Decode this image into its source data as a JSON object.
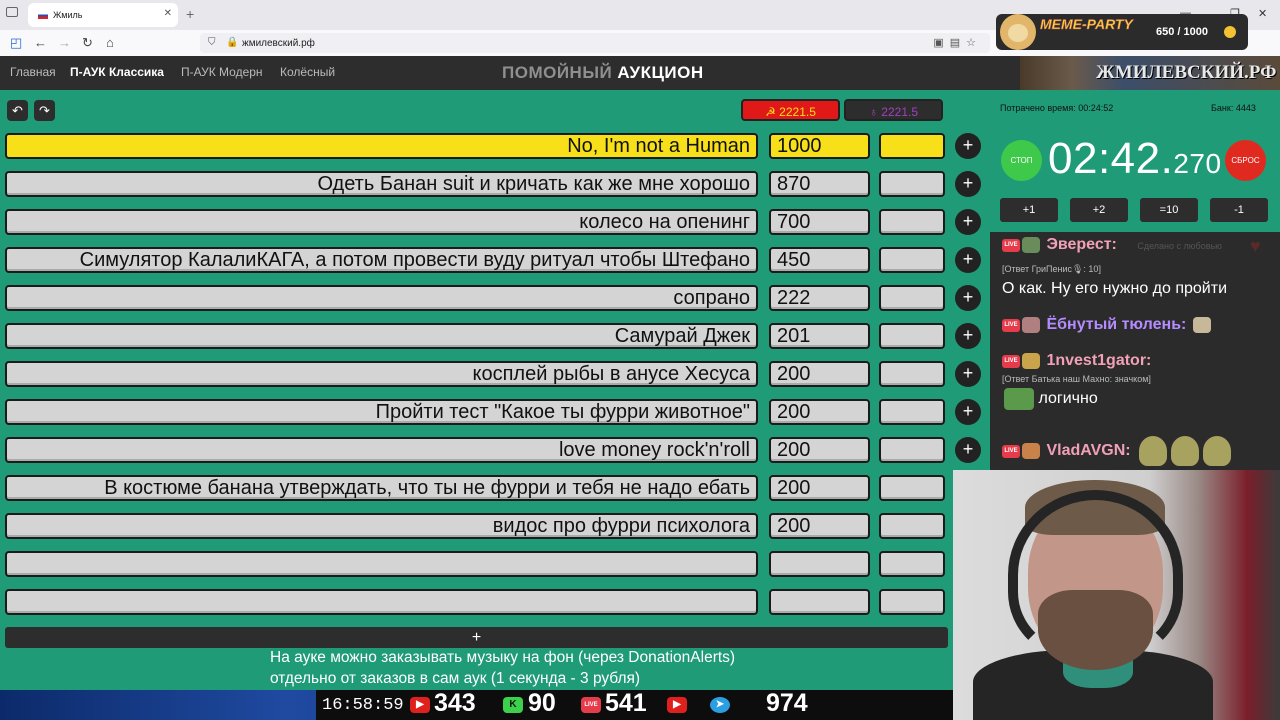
{
  "browser": {
    "tab_title": "Жмиль",
    "url": "жмилевский.рф",
    "meme_party": {
      "logo": "MEME-PARTY",
      "count": "650 / 1000"
    }
  },
  "app": {
    "nav": [
      "Главная",
      "П-АУК Классика",
      "П-АУК Модерн",
      "Колёсный"
    ],
    "active_nav": "П-АУК Классика",
    "title_dim": "ПОМОЙНЫЙ",
    "title_main": "АУКЦИОН",
    "banner": "ЖМИЛЕВСКИЙ.РФ"
  },
  "controls": {
    "undo_icon": "↶",
    "redo_icon": "↷",
    "total_red": "☭ 2221.5",
    "total_dark": "♁ 2221.5",
    "add_lot": "+",
    "plus": "+"
  },
  "lots": [
    {
      "name": "No, I'm not a Human",
      "amount": "1000"
    },
    {
      "name": "Одеть Банан suit и кричать как же мне хорошо",
      "amount": "870"
    },
    {
      "name": "колесо на опенинг",
      "amount": "700"
    },
    {
      "name": "Симулятор КалалиКАГА, а потом провести вуду ритуал чтобы Штефано",
      "amount": "450"
    },
    {
      "name": "сопрано",
      "amount": "222"
    },
    {
      "name": "Самурай Джек",
      "amount": "201"
    },
    {
      "name": "косплей рыбы в анусе Хесуса",
      "amount": "200"
    },
    {
      "name": "Пройти тест \"Какое ты фурри животное\"",
      "amount": "200"
    },
    {
      "name": "love money rock'n'roll",
      "amount": "200"
    },
    {
      "name": "В костюме банана утверждать, что ты не фурри и тебя не надо ебать",
      "amount": "200"
    },
    {
      "name": "видос про фурри психолога",
      "amount": "200"
    },
    {
      "name": "",
      "amount": ""
    },
    {
      "name": "",
      "amount": ""
    }
  ],
  "notice": {
    "line1": "На ауке можно заказывать музыку на фон (через DonationAlerts)",
    "line2": "отдельно от заказов в сам аук (1 секунда - 3 рубля)"
  },
  "timer": {
    "spent": "Потрачено время: 00:24:52",
    "bank": "Банк: 4443",
    "stop": "СТОП",
    "reset": "СБРОС",
    "main": "02:42.",
    "ms": "270",
    "buttons": [
      "+1",
      "+2",
      "=10",
      "-1"
    ]
  },
  "chat": {
    "live_badge": "LIVE",
    "faded": "Сделано с любовью",
    "messages": [
      {
        "user": "Эверест:",
        "color": "#f1a0b8",
        "reply": "",
        "text": ""
      },
      {
        "user": "",
        "color": "",
        "reply": "[Ответ ГриПенис🎙: 10]",
        "text": "О как. Ну его нужно до пройти"
      },
      {
        "user": "Ёбнутый тюлень:",
        "color": "#b58cff",
        "reply": "",
        "text": ""
      },
      {
        "user": "1nvest1gator:",
        "color": "#f1a0b8",
        "reply": "[Ответ Батька наш Махно: значком]",
        "text": "логично"
      },
      {
        "user": "VladAVGN:",
        "color": "#f1a0b8",
        "reply": "",
        "text": ""
      }
    ]
  },
  "footer": {
    "clock": "16:58:59",
    "youtube": "343",
    "kick": "90",
    "vk_live": "541",
    "telegram": "974"
  },
  "colors": {
    "accent_yellow": "#f7e01a",
    "stop_green": "#3ec94a",
    "reset_red": "#e02a1f",
    "background": "#1f9b78"
  }
}
